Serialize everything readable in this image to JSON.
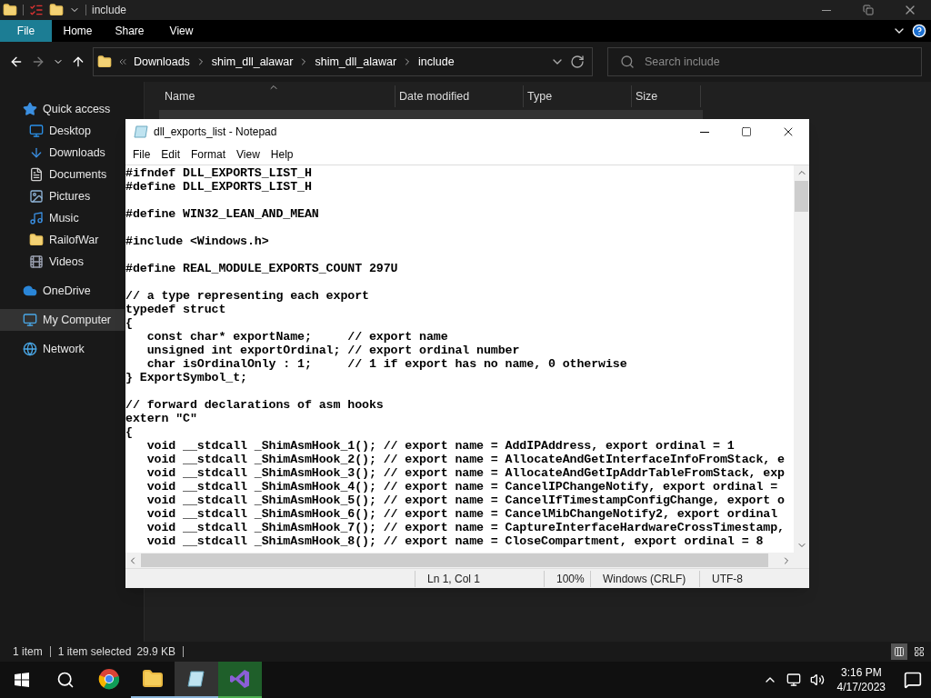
{
  "explorer": {
    "title": "include",
    "ribbon_tabs": [
      {
        "label": "File",
        "selected": true
      },
      {
        "label": "Home",
        "selected": false
      },
      {
        "label": "Share",
        "selected": false
      },
      {
        "label": "View",
        "selected": false
      }
    ],
    "breadcrumbs": [
      "Downloads",
      "shim_dll_alawar",
      "shim_dll_alawar",
      "include"
    ],
    "search": {
      "placeholder": "Search include"
    },
    "columns": [
      "Name",
      "Date modified",
      "Type",
      "Size"
    ],
    "sidebar": [
      {
        "label": "Quick access",
        "kind": "star",
        "selected": false,
        "top": true
      },
      {
        "label": "Desktop",
        "kind": "desktop",
        "selected": false,
        "top": false
      },
      {
        "label": "Downloads",
        "kind": "download",
        "selected": false,
        "top": false
      },
      {
        "label": "Documents",
        "kind": "document",
        "selected": false,
        "top": false
      },
      {
        "label": "Pictures",
        "kind": "picture",
        "selected": false,
        "top": false
      },
      {
        "label": "Music",
        "kind": "music",
        "selected": false,
        "top": false
      },
      {
        "label": "RailofWar",
        "kind": "folder",
        "selected": false,
        "top": false
      },
      {
        "label": "Videos",
        "kind": "video",
        "selected": false,
        "top": false
      },
      {
        "label": "OneDrive",
        "kind": "cloud",
        "selected": false,
        "top": true
      },
      {
        "label": "My Computer",
        "kind": "computer",
        "selected": true,
        "top": true
      },
      {
        "label": "Network",
        "kind": "network",
        "selected": false,
        "top": true
      }
    ],
    "status": {
      "items": "1 item",
      "selected": "1 item selected",
      "size": "29.9 KB"
    }
  },
  "notepad": {
    "title": "dll_exports_list - Notepad",
    "menu": [
      "File",
      "Edit",
      "Format",
      "View",
      "Help"
    ],
    "blocks": [
      [
        "#ifndef DLL_EXPORTS_LIST_H",
        "#define DLL_EXPORTS_LIST_H"
      ],
      [
        "#define WIN32_LEAN_AND_MEAN"
      ],
      [
        "#include <Windows.h>"
      ],
      [
        "#define REAL_MODULE_EXPORTS_COUNT 297U"
      ],
      [
        "// a type representing each export",
        "typedef struct",
        "{",
        "   const char* exportName;     // export name",
        "   unsigned int exportOrdinal; // export ordinal number",
        "   char isOrdinalOnly : 1;     // 1 if export has no name, 0 otherwise",
        "} ExportSymbol_t;"
      ],
      [
        "// forward declarations of asm hooks",
        "extern \"C\"",
        "{",
        "   void __stdcall _ShimAsmHook_1(); // export name = AddIPAddress, export ordinal = 1",
        "   void __stdcall _ShimAsmHook_2(); // export name = AllocateAndGetInterfaceInfoFromStack, e",
        "   void __stdcall _ShimAsmHook_3(); // export name = AllocateAndGetIpAddrTableFromStack, exp",
        "   void __stdcall _ShimAsmHook_4(); // export name = CancelIPChangeNotify, export ordinal =",
        "   void __stdcall _ShimAsmHook_5(); // export name = CancelIfTimestampConfigChange, export o",
        "   void __stdcall _ShimAsmHook_6(); // export name = CancelMibChangeNotify2, export ordinal",
        "   void __stdcall _ShimAsmHook_7(); // export name = CaptureInterfaceHardwareCrossTimestamp,",
        "   void __stdcall _ShimAsmHook_8(); // export name = CloseCompartment, export ordinal = 8"
      ]
    ],
    "status": [
      "Ln 1, Col 1",
      "100%",
      "Windows (CRLF)",
      "UTF-8"
    ]
  },
  "taskbar": {
    "apps": [
      {
        "kind": "browser",
        "running": false,
        "active": false,
        "flashing": false
      },
      {
        "kind": "explorer",
        "running": true,
        "active": false,
        "flashing": false
      },
      {
        "kind": "notepad",
        "running": true,
        "active": true,
        "flashing": false
      },
      {
        "kind": "studio",
        "running": true,
        "active": false,
        "flashing": true
      }
    ],
    "time": "3:16 PM",
    "date": "4/17/2023"
  }
}
